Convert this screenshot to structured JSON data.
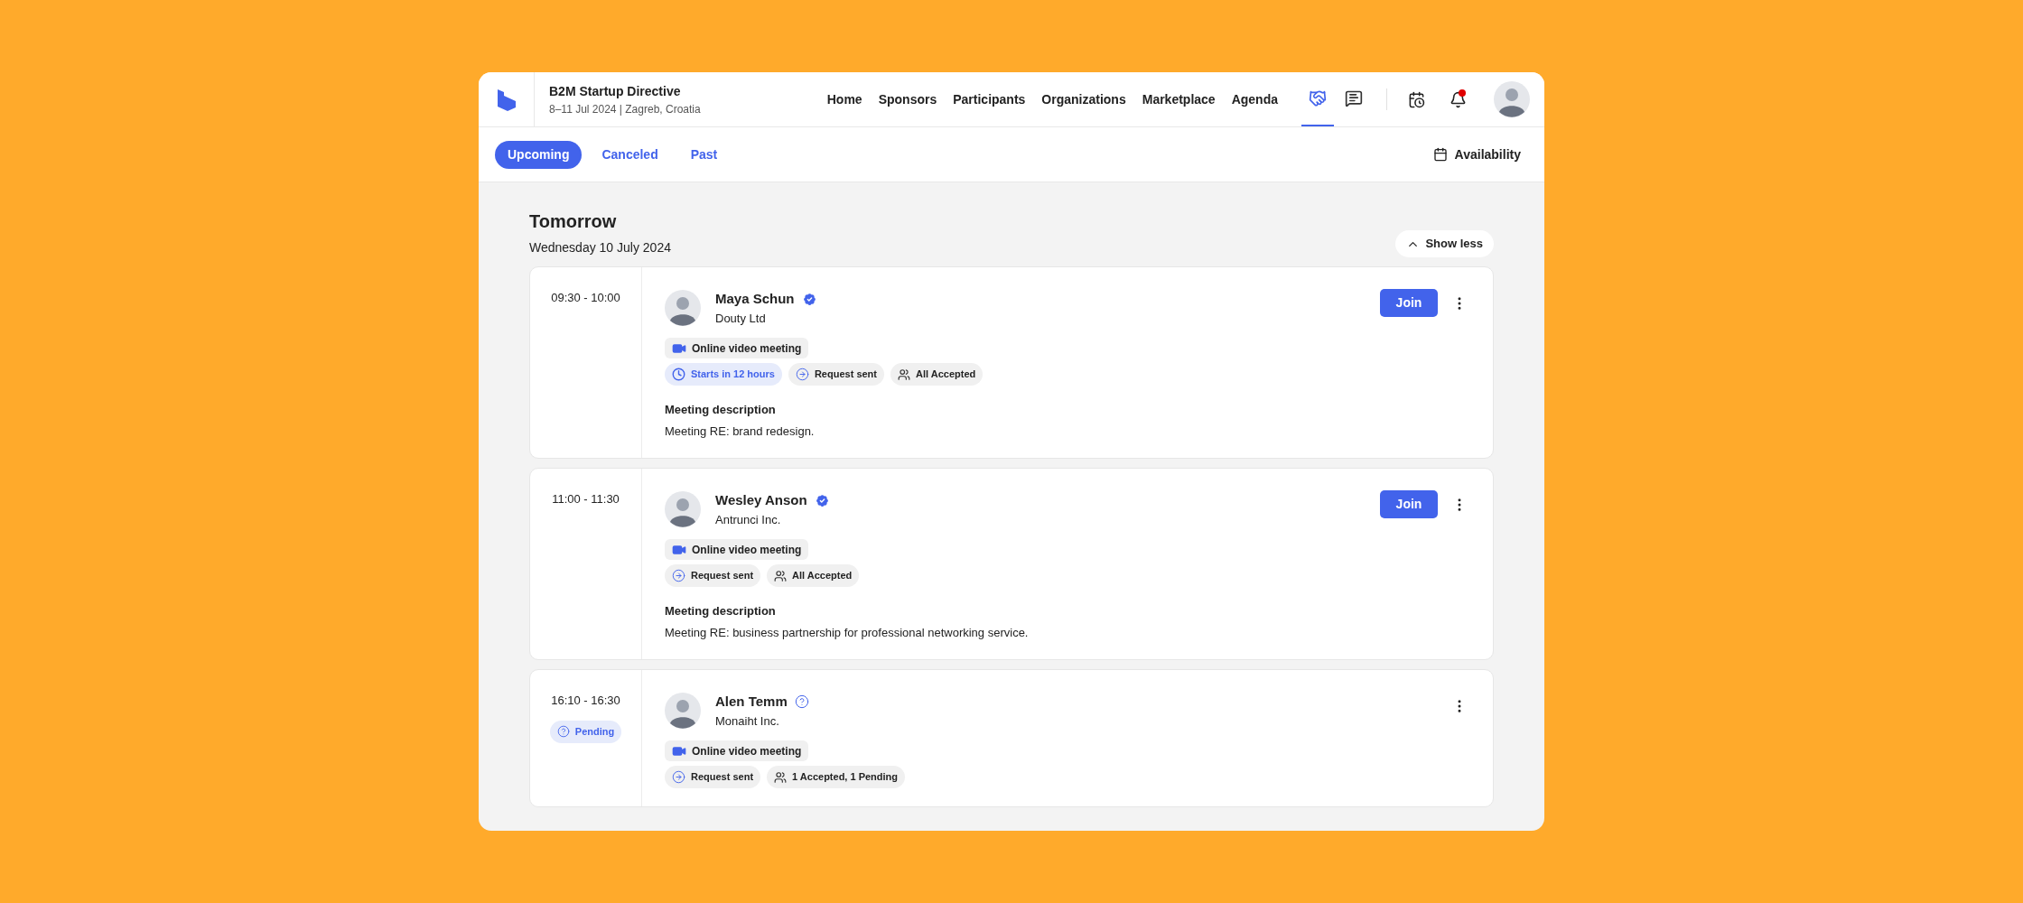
{
  "event": {
    "title": "B2M Startup Directive",
    "subtitle": "8–11 Jul 2024 | Zagreb, Croatia"
  },
  "nav": [
    "Home",
    "Sponsors",
    "Participants",
    "Organizations",
    "Marketplace",
    "Agenda"
  ],
  "nav_icons": [
    {
      "kind": "handshake",
      "selected": true
    },
    {
      "kind": "chat",
      "selected": false
    }
  ],
  "tool_icons": [
    {
      "kind": "calendar",
      "badge": false
    },
    {
      "kind": "bell",
      "badge": true
    }
  ],
  "tabs": [
    {
      "label": "Upcoming",
      "selected": true
    },
    {
      "label": "Canceled",
      "selected": false
    },
    {
      "label": "Past",
      "selected": false
    }
  ],
  "availability": "Availability",
  "day": {
    "title": "Tomorrow",
    "date": "Wednesday 10 July 2024",
    "toggle": "Show less"
  },
  "meetings": [
    {
      "time": "09:30 - 10:00",
      "name": "Maya Schun",
      "verified": true,
      "company": "Douty Ltd",
      "type": "Online video meeting",
      "tags": [
        {
          "kind": "countdown",
          "label": "Starts in 12 hours"
        },
        {
          "kind": "request",
          "label": "Request sent"
        },
        {
          "kind": "attendees",
          "label": "All Accepted"
        }
      ],
      "description_title": "Meeting description",
      "description": "Meeting RE: brand redesign.",
      "join": "Join"
    },
    {
      "time": "11:00 - 11:30",
      "name": "Wesley Anson",
      "verified": true,
      "company": "Antrunci Inc.",
      "type": "Online video meeting",
      "tags": [
        {
          "kind": "request",
          "label": "Request sent"
        },
        {
          "kind": "attendees",
          "label": "All Accepted"
        }
      ],
      "description_title": "Meeting description",
      "description": "Meeting RE: business partnership for professional networking service.",
      "join": "Join"
    },
    {
      "time": "16:10 - 16:30",
      "status": "Pending",
      "name": "Alen Temm",
      "verified": false,
      "company": "Monaiht Inc.",
      "type": "Online video meeting",
      "tags": [
        {
          "kind": "request",
          "label": "Request sent"
        },
        {
          "kind": "attendees",
          "label": "1 Accepted, 1 Pending"
        }
      ]
    }
  ]
}
